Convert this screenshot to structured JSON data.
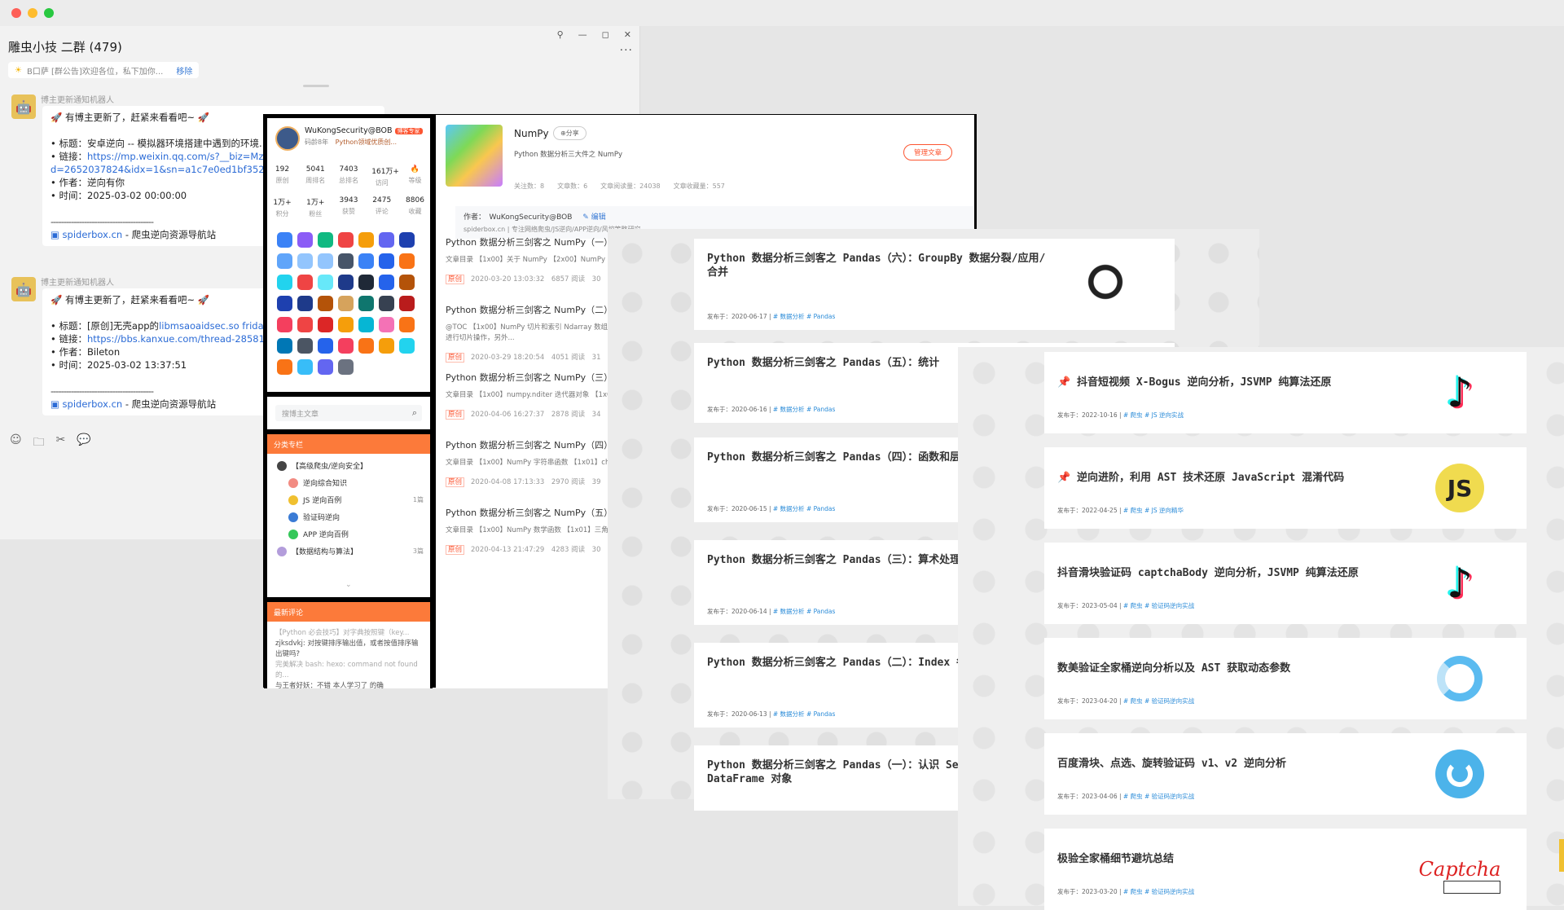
{
  "chat": {
    "title": "雕虫小技 二群 (479)",
    "window_controls": [
      "⚲",
      "—",
      "◻",
      "✕"
    ],
    "more": "···",
    "notice": {
      "icon": "☀",
      "text": "B口萨 [群公告]欢迎各位，私下加你...",
      "action": "移除"
    },
    "messages": [
      {
        "sender": "博主更新通知机器人",
        "lines": [
          {
            "text": "🚀 有博主更新了，赶紧来看看吧~ 🚀",
            "link": ""
          },
          {
            "text": "",
            "link": ""
          },
          {
            "text": "• 标题：安卓逆向 -- 模拟器环境搭建中遇到的环境...",
            "link": ""
          },
          {
            "text": "• 链接：",
            "link": "https://mp.weixin.qq.com/s?__biz=MzA"
          },
          {
            "text": "",
            "link": "d=2652037824&idx=1&sn=a1c7e0ed1bf35292"
          },
          {
            "text": "• 作者：逆向有你",
            "link": ""
          },
          {
            "text": "• 时间：2025-03-02 00:00:00",
            "link": ""
          },
          {
            "text": "",
            "link": ""
          },
          {
            "text": "----------------------------------------",
            "link": ""
          },
          {
            "text": " - 爬虫逆向资源导航站",
            "link": "spiderbox.cn"
          }
        ]
      },
      {
        "sender": "博主更新通知机器人",
        "lines": [
          {
            "text": "🚀 有博主更新了，赶紧来看看吧~ 🚀",
            "link": ""
          },
          {
            "text": "",
            "link": ""
          },
          {
            "text": "• 标题：[原创]无壳app的",
            "link": "libmsaoaidsec.so frida反"
          },
          {
            "text": "• 链接：",
            "link": "https://bbs.kanxue.com/thread-285811"
          },
          {
            "text": "• 作者：Bileton",
            "link": ""
          },
          {
            "text": "• 时间：2025-03-02 13:37:51",
            "link": ""
          },
          {
            "text": "",
            "link": ""
          },
          {
            "text": "----------------------------------------",
            "link": ""
          },
          {
            "text": " - 爬虫逆向资源导航站",
            "link": "spiderbox.cn"
          }
        ]
      }
    ],
    "tools": [
      "☺",
      "🗀",
      "✂",
      "💬"
    ]
  },
  "blog": {
    "profile": {
      "name": "WuKongSecurity@BOB",
      "badge": "博客专家",
      "level": "码龄8年",
      "tag": "Python领域优质创...",
      "stats_row1": [
        {
          "value": "192",
          "label": "原创"
        },
        {
          "value": "5041",
          "label": "周排名"
        },
        {
          "value": "7403",
          "label": "总排名"
        },
        {
          "value": "161万+",
          "label": "访问"
        },
        {
          "value": "🔥",
          "label": "等级"
        }
      ],
      "stats_row2": [
        {
          "value": "1万+",
          "label": "积分"
        },
        {
          "value": "1万+",
          "label": "粉丝"
        },
        {
          "value": "3943",
          "label": "获赞"
        },
        {
          "value": "2475",
          "label": "评论"
        },
        {
          "value": "8806",
          "label": "收藏"
        }
      ],
      "badge_colors": [
        "#3b82f6",
        "#8b5cf6",
        "#10b981",
        "#ef4444",
        "#f59e0b",
        "#6366f1",
        "#1e40af",
        "#60a5fa",
        "#93c5fd",
        "#93c5fd",
        "#475569",
        "#3b82f6",
        "#2563eb",
        "#f97316",
        "#22d3ee",
        "#ef4444",
        "#67e8f9",
        "#1e3a8a",
        "#1f2937",
        "#2563eb",
        "#b45309",
        "#1e40af",
        "#1e3a8a",
        "#b45309",
        "#d6a35c",
        "#0f766e",
        "#374151",
        "#b91c1c",
        "#f43f5e",
        "#ef4444",
        "#dc2626",
        "#f59e0b",
        "#06b6d4",
        "#f472b6",
        "#f97316",
        "#0077b5",
        "#4b5563",
        "#2563eb",
        "#f43f5e",
        "#f97316",
        "#f59e0b",
        "#22d3ee",
        "#f97316",
        "#38bdf8",
        "#6366f1",
        "#6b7280"
      ]
    },
    "search_placeholder": "搜博主文章",
    "category_head": "分类专栏",
    "categories": [
      {
        "label": "【高级爬虫/逆向安全】",
        "count": ""
      },
      {
        "label": "逆向综合知识",
        "count": ""
      },
      {
        "label": "JS 逆向百例",
        "count": "1篇"
      },
      {
        "label": "验证码逆向",
        "count": ""
      },
      {
        "label": "APP 逆向百例",
        "count": ""
      },
      {
        "label": "【数据结构与算法】",
        "count": "3篇"
      }
    ],
    "category_more": "⌄",
    "comments_head": "最新评论",
    "comments": [
      {
        "text": "【Python 必会技巧】对字典按照键（key...",
        "dim": true
      },
      {
        "text": "zjksdvkj: 对按键排序输出值，或者按值排序输出键吗?",
        "dim": false
      },
      {
        "text": "完美解决 bash: hexo: command not found 的...",
        "dim": true
      },
      {
        "text": "与王者好妖：不错 本人学习了 的确",
        "dim": false
      }
    ],
    "column": {
      "name": "NumPy",
      "share": "⊕分享",
      "desc": "Python 数据分析三大件之 NumPy",
      "stats": "关注数：8　　文章数：6　　文章阅读量：24038　　文章收藏量：557",
      "manage": "管理文章",
      "author": "作者：　WuKongSecurity@BOB",
      "edit": "✎ 编辑",
      "author_sub": "spiderbox.cn | 专注网络爬虫/JS逆向/APP逆向/风控策略研究"
    },
    "articles": [
      {
        "title": "Python 数据分析三剑客之 NumPy（一）：理解 NumPy / 数组基础",
        "excerpt": "文章目录 【1x00】关于 NumPy 【2x00】NumPy 数组基础【1x00】关于 NumPy NumPy 是使用 Python 进行科学计算的基础包",
        "orig": "原创",
        "date": "2020-03-20 13:03:32",
        "reads": "6857 阅读",
        "extra": "30"
      },
      {
        "title": "Python 数据分析三剑客之 NumPy（二）：数组索引 / 切片 / 广播 / 拼接 / 分割",
        "excerpt": "@TOC 【1x00】NumPy 切片和索引 Ndarray 数组对象的内容可以通过索引或切片来访问和修改，与 Python 中 list 的切片操作一样，切片参数 [start:stop:step] 来进行切片操作，另外...",
        "orig": "原创",
        "date": "2020-03-29 18:20:54",
        "reads": "4051 阅读",
        "extra": "31"
      },
      {
        "title": "Python 数据分析三剑客之 NumPy（三）：数组的迭代与位运算",
        "excerpt": "文章目录 【1x00】numpy.nditer 迭代器对象 【1x01】...",
        "orig": "原创",
        "date": "2020-04-06 16:27:37",
        "reads": "2878 阅读",
        "extra": "34"
      },
      {
        "title": "Python 数据分析三剑客之 NumPy（四）：字符串函数总结与对比",
        "excerpt": "文章目录 【1x00】NumPy 字符串函数 【1x01】chararray（numpy.char）中定义。字符串函数快速查表 函数...",
        "orig": "原创",
        "date": "2020-04-08 17:13:33",
        "reads": "2970 阅读",
        "extra": "39"
      },
      {
        "title": "Python 数据分析三剑客之 NumPy（五）：数学 / 算术 / 统计函数",
        "excerpt": "文章目录 【1x00】NumPy 数学函数 【1x01】三角函数 成绩差，在 NumPy 中的转化公式：角度 * numpy...",
        "orig": "原创",
        "date": "2020-04-13 21:47:29",
        "reads": "4283 阅读",
        "extra": "30"
      }
    ]
  },
  "pandas": {
    "meta_prefix": "发布于：",
    "tag1": "# 数据分析",
    "tag2": "# Pandas",
    "cards": [
      {
        "title": "Python 数据分析三剑客之 Pandas（六）：GroupBy 数据分裂/应用/合并",
        "date": "2020-06-17"
      },
      {
        "title": "Python 数据分析三剑客之 Pandas（五）：统计",
        "date": "2020-06-16"
      },
      {
        "title": "Python 数据分析三剑客之 Pandas（四）：函数和层级索引",
        "date": "2020-06-15"
      },
      {
        "title": "Python 数据分析三剑客之 Pandas（三）：算术处理",
        "date": "2020-06-14"
      },
      {
        "title": "Python 数据分析三剑客之 Pandas（二）：Index 各种索引操作",
        "date": "2020-06-13"
      },
      {
        "title": "Python 数据分析三剑客之 Pandas（一）：认识 Series、DataFrame 对象",
        "date": ""
      }
    ]
  },
  "douyin": {
    "meta_prefix": "发布于：",
    "cards": [
      {
        "pin": "📌",
        "title": "抖音短视频 X-Bogus 逆向分析，JSVMP 纯算法还原",
        "date": "2022-10-16",
        "tag1": "# 爬虫",
        "tag2": "# JS 逆向实战",
        "icon": "tiktok-icon"
      },
      {
        "pin": "📌",
        "title": "逆向进阶，利用 AST 技术还原 JavaScript 混淆代码",
        "date": "2022-04-25",
        "tag1": "# 爬虫",
        "tag2": "# JS 逆向精华",
        "icon": "js-icon"
      },
      {
        "pin": "",
        "title": "抖音滑块验证码 captchaBody 逆向分析，JSVMP 纯算法还原",
        "date": "2023-05-04",
        "tag1": "# 爬虫",
        "tag2": "# 验证码逆向实战",
        "icon": "tiktok-icon"
      },
      {
        "pin": "",
        "title": "数美验证全家桶逆向分析以及 AST 获取动态参数",
        "date": "2023-04-20",
        "tag1": "# 爬虫",
        "tag2": "# 验证码逆向实战",
        "icon": "shumei-icon"
      },
      {
        "pin": "",
        "title": "百度滑块、点选、旋转验证码 v1、v2 逆向分析",
        "date": "2023-04-06",
        "tag1": "# 爬虫",
        "tag2": "# 验证码逆向实战",
        "icon": "baidu-captcha-icon"
      },
      {
        "pin": "",
        "title": "极验全家桶细节避坑总结",
        "date": "2023-03-20",
        "tag1": "# 爬虫",
        "tag2": "# 验证码逆向实战",
        "icon": "captcha-icon",
        "icon_text": "Captcha"
      }
    ]
  }
}
